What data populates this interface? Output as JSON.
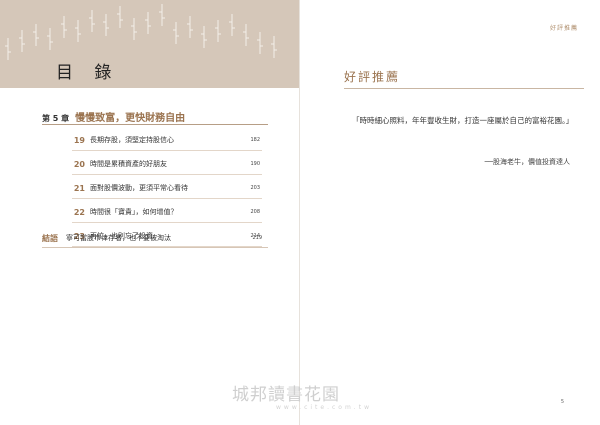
{
  "left_page": {
    "toc_title": "目 錄",
    "chapter": {
      "label": "第 5 章",
      "title": "慢慢致富，更快財務自由",
      "items": [
        {
          "number": "19",
          "title": "長期存股，須堅定持股信心",
          "page": "182"
        },
        {
          "number": "20",
          "title": "時間是累積資產的好朋友",
          "page": "190"
        },
        {
          "number": "21",
          "title": "面對股價波動，更須平常心看待",
          "page": "203"
        },
        {
          "number": "22",
          "title": "時間很「寶貴」，如何增值？",
          "page": "208"
        },
        {
          "number": "23",
          "title": "再忙，也別忘了投資",
          "page": "214"
        }
      ]
    },
    "conclusion": {
      "label": "結語",
      "title": "寧可當股市倖存者，也不要被淘汰",
      "page": "219"
    }
  },
  "right_page": {
    "running_head": "好評推薦",
    "section_title": "好評推薦",
    "quote": "「時時細心照料，年年豐收生財，打造一座屬於自己的富裕花園。」",
    "attribution": "──股海老牛，價值投資達人",
    "page_number": "5"
  },
  "watermark": {
    "text": "城邦讀書花園",
    "url": "www.cite.com.tw"
  },
  "colors": {
    "accent": "#9b7450",
    "header_band": "#d5c7b9",
    "rule": "#b79e86"
  }
}
